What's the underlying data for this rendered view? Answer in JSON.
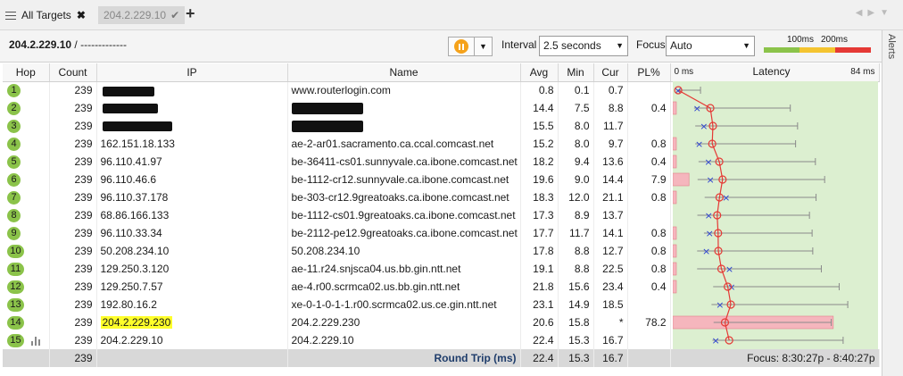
{
  "tabs": {
    "all_targets": "All Targets",
    "target": "204.2.229.10",
    "add": "+"
  },
  "toolbar": {
    "target": "204.2.229.10",
    "path_suffix": " / -------------",
    "interval_label": "Interval",
    "interval_value": "2.5 seconds",
    "focus_label": "Focus",
    "focus_value": "Auto",
    "legend_100": "100ms",
    "legend_200": "200ms",
    "legend_colors": [
      "#8bc34a",
      "#f4c430",
      "#e53935"
    ]
  },
  "alerts_label": "Alerts",
  "columns": {
    "hop": "Hop",
    "count": "Count",
    "ip": "IP",
    "name": "Name",
    "avg": "Avg",
    "min": "Min",
    "cur": "Cur",
    "pl": "PL%",
    "latency": "Latency",
    "lat_min": "0 ms",
    "lat_max": "84 ms"
  },
  "rows": [
    {
      "hop": "1",
      "count": "239",
      "ip": "",
      "name": "www.routerlogin.com",
      "avg": "0.8",
      "min": "0.1",
      "cur": "0.7",
      "pl": ""
    },
    {
      "hop": "2",
      "count": "239",
      "ip": "",
      "name": "",
      "avg": "14.4",
      "min": "7.5",
      "cur": "8.8",
      "pl": "0.4"
    },
    {
      "hop": "3",
      "count": "239",
      "ip": "",
      "name": "",
      "avg": "15.5",
      "min": "8.0",
      "cur": "11.7",
      "pl": ""
    },
    {
      "hop": "4",
      "count": "239",
      "ip": "162.151.18.133",
      "name": "ae-2-ar01.sacramento.ca.ccal.comcast.net",
      "avg": "15.2",
      "min": "8.0",
      "cur": "9.7",
      "pl": "0.8"
    },
    {
      "hop": "5",
      "count": "239",
      "ip": "96.110.41.97",
      "name": "be-36411-cs01.sunnyvale.ca.ibone.comcast.net",
      "avg": "18.2",
      "min": "9.4",
      "cur": "13.6",
      "pl": "0.4"
    },
    {
      "hop": "6",
      "count": "239",
      "ip": "96.110.46.6",
      "name": "be-1112-cr12.sunnyvale.ca.ibone.comcast.net",
      "avg": "19.6",
      "min": "9.0",
      "cur": "14.4",
      "pl": "7.9"
    },
    {
      "hop": "7",
      "count": "239",
      "ip": "96.110.37.178",
      "name": "be-303-cr12.9greatoaks.ca.ibone.comcast.net",
      "avg": "18.3",
      "min": "12.0",
      "cur": "21.1",
      "pl": "0.8"
    },
    {
      "hop": "8",
      "count": "239",
      "ip": "68.86.166.133",
      "name": "be-1112-cs01.9greatoaks.ca.ibone.comcast.net",
      "avg": "17.3",
      "min": "8.9",
      "cur": "13.7",
      "pl": ""
    },
    {
      "hop": "9",
      "count": "239",
      "ip": "96.110.33.34",
      "name": "be-2112-pe12.9greatoaks.ca.ibone.comcast.net",
      "avg": "17.7",
      "min": "11.7",
      "cur": "14.1",
      "pl": "0.8"
    },
    {
      "hop": "10",
      "count": "239",
      "ip": "50.208.234.10",
      "name": "50.208.234.10",
      "avg": "17.8",
      "min": "8.8",
      "cur": "12.7",
      "pl": "0.8"
    },
    {
      "hop": "11",
      "count": "239",
      "ip": "129.250.3.120",
      "name": "ae-11.r24.snjsca04.us.bb.gin.ntt.net",
      "avg": "19.1",
      "min": "8.8",
      "cur": "22.5",
      "pl": "0.8"
    },
    {
      "hop": "12",
      "count": "239",
      "ip": "129.250.7.57",
      "name": "ae-4.r00.scrmca02.us.bb.gin.ntt.net",
      "avg": "21.8",
      "min": "15.6",
      "cur": "23.4",
      "pl": "0.4"
    },
    {
      "hop": "13",
      "count": "239",
      "ip": "192.80.16.2",
      "name": "xe-0-1-0-1-1.r00.scrmca02.us.ce.gin.ntt.net",
      "avg": "23.1",
      "min": "14.9",
      "cur": "18.5",
      "pl": ""
    },
    {
      "hop": "14",
      "count": "239",
      "ip": "204.2.229.230",
      "name": "204.2.229.230",
      "avg": "20.6",
      "min": "15.8",
      "cur": "*",
      "pl": "78.2"
    },
    {
      "hop": "15",
      "count": "239",
      "ip": "204.2.229.10",
      "name": "204.2.229.10",
      "avg": "22.4",
      "min": "15.3",
      "cur": "16.7",
      "pl": ""
    }
  ],
  "totals": {
    "count": "239",
    "label": "Round Trip (ms)",
    "avg": "22.4",
    "min": "15.3",
    "cur": "16.7",
    "focus": "Focus: 8:30:27p - 8:40:27p"
  },
  "chart_data": {
    "type": "scatter",
    "xlim": [
      0,
      84
    ],
    "avg": [
      0.8,
      14.4,
      15.5,
      15.2,
      18.2,
      19.6,
      18.3,
      17.3,
      17.7,
      17.8,
      19.1,
      21.8,
      23.1,
      20.6,
      22.4
    ],
    "min": [
      0.1,
      7.5,
      8.0,
      8.0,
      9.4,
      9.0,
      12.0,
      8.9,
      11.7,
      8.8,
      8.8,
      15.6,
      14.9,
      15.8,
      15.3
    ],
    "cur": [
      0.7,
      8.8,
      11.7,
      9.7,
      13.6,
      14.4,
      21.1,
      13.7,
      14.1,
      12.7,
      22.5,
      23.4,
      18.5,
      null,
      16.7
    ],
    "pl": [
      0,
      0.4,
      0,
      0.8,
      0.4,
      7.9,
      0.8,
      0,
      0.8,
      0.8,
      0.8,
      0.4,
      0,
      78.2,
      0
    ]
  }
}
